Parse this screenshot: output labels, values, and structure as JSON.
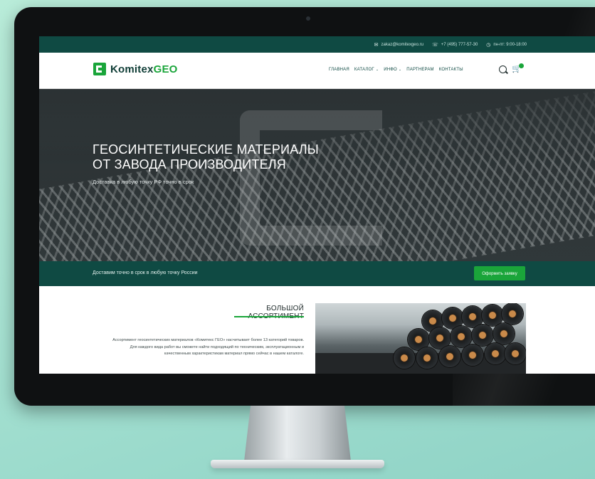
{
  "topbar": {
    "email": "zakaz@komitexgeo.ru",
    "phone": "+7 (495) 777-57-30",
    "hours": "пн-пт: 9:00-18:00"
  },
  "header": {
    "logo_main": "Komitex",
    "logo_accent": "GEO",
    "nav": {
      "home": "ГЛАВНАЯ",
      "catalog": "КАТАЛОГ",
      "info": "ИНФО",
      "partners": "ПАРТНЕРАМ",
      "contacts": "КОНТАКТЫ"
    },
    "cart_count": ""
  },
  "hero": {
    "title_line1": "ГЕОСИНТЕТИЧЕСКИЕ МАТЕРИАЛЫ",
    "title_line2": "ОТ ЗАВОДА ПРОИЗВОДИТЕЛЯ",
    "subtitle": "Доставка в любую точку РФ точно в срок"
  },
  "strip": {
    "text": "Доставим точно в срок в любую точку России",
    "button": "Оформить заявку"
  },
  "section": {
    "title": "БОЛЬШОЙ АССОРТИМЕНТ",
    "text": "Ассортимент геосинтетических материалов «Комитекс ГЕО» насчитывает более 13 категорий товаров. Для каждого вида работ вы сможете найти подходящий по техническим, эксплуатационным и качественным характеристикам материал прямо сейчас в нашем каталоге."
  },
  "colors": {
    "brand_dark": "#0f4a43",
    "brand_green": "#1aa53a"
  }
}
